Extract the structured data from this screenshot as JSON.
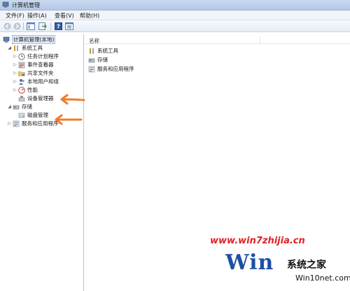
{
  "window": {
    "title": "计算机管理"
  },
  "menu": [
    "文件(F)",
    "操作(A)",
    "查看(V)",
    "帮助(H)"
  ],
  "toolbar": {
    "icons": [
      "back-arrow-icon",
      "forward-arrow-icon",
      "show-tree-icon",
      "export-list-icon",
      "help-icon",
      "properties-icon"
    ]
  },
  "tree": {
    "root": "计算机管理(本地)",
    "items": [
      {
        "label": "系统工具",
        "icon": "tools-icon",
        "expanded": true
      },
      {
        "label": "任务计划程序",
        "icon": "clock-icon"
      },
      {
        "label": "事件查看器",
        "icon": "event-viewer-icon"
      },
      {
        "label": "共享文件夹",
        "icon": "shared-folder-icon"
      },
      {
        "label": "本地用户和组",
        "icon": "users-icon"
      },
      {
        "label": "性能",
        "icon": "performance-icon"
      },
      {
        "label": "设备管理器",
        "icon": "device-manager-icon"
      },
      {
        "label": "存储",
        "icon": "storage-icon",
        "expanded": true
      },
      {
        "label": "磁盘管理",
        "icon": "disk-icon"
      },
      {
        "label": "服务和应用程序",
        "icon": "services-icon"
      }
    ]
  },
  "list": {
    "header": "名称",
    "items": [
      "系统工具",
      "存储",
      "服务和应用程序"
    ]
  },
  "watermark": {
    "url": "www.win7zhijia.cn",
    "logo_text": "Win",
    "brand": "系统之家",
    "site": "Win10net.com"
  },
  "colors": {
    "annotation_arrow": "#f07c2c",
    "watermark_red": "#e02020",
    "logo_blue": "#1d4fa5"
  }
}
